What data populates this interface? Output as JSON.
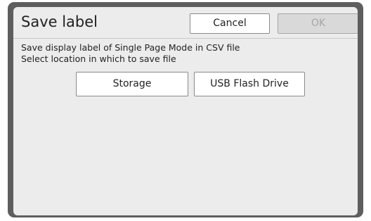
{
  "dialog": {
    "title": "Save label",
    "cancel_label": "Cancel",
    "ok_label": "OK",
    "message_line1": "Save display label of Single Page Mode in CSV file",
    "message_line2": "Select location in which to save file",
    "storage_label": "Storage",
    "usb_label": "USB Flash Drive"
  },
  "colors": {
    "frame": "#5e5e5e",
    "dialog_bg": "#ececec",
    "button_bg": "#ffffff",
    "disabled_button_bg": "#d9d9d9"
  }
}
